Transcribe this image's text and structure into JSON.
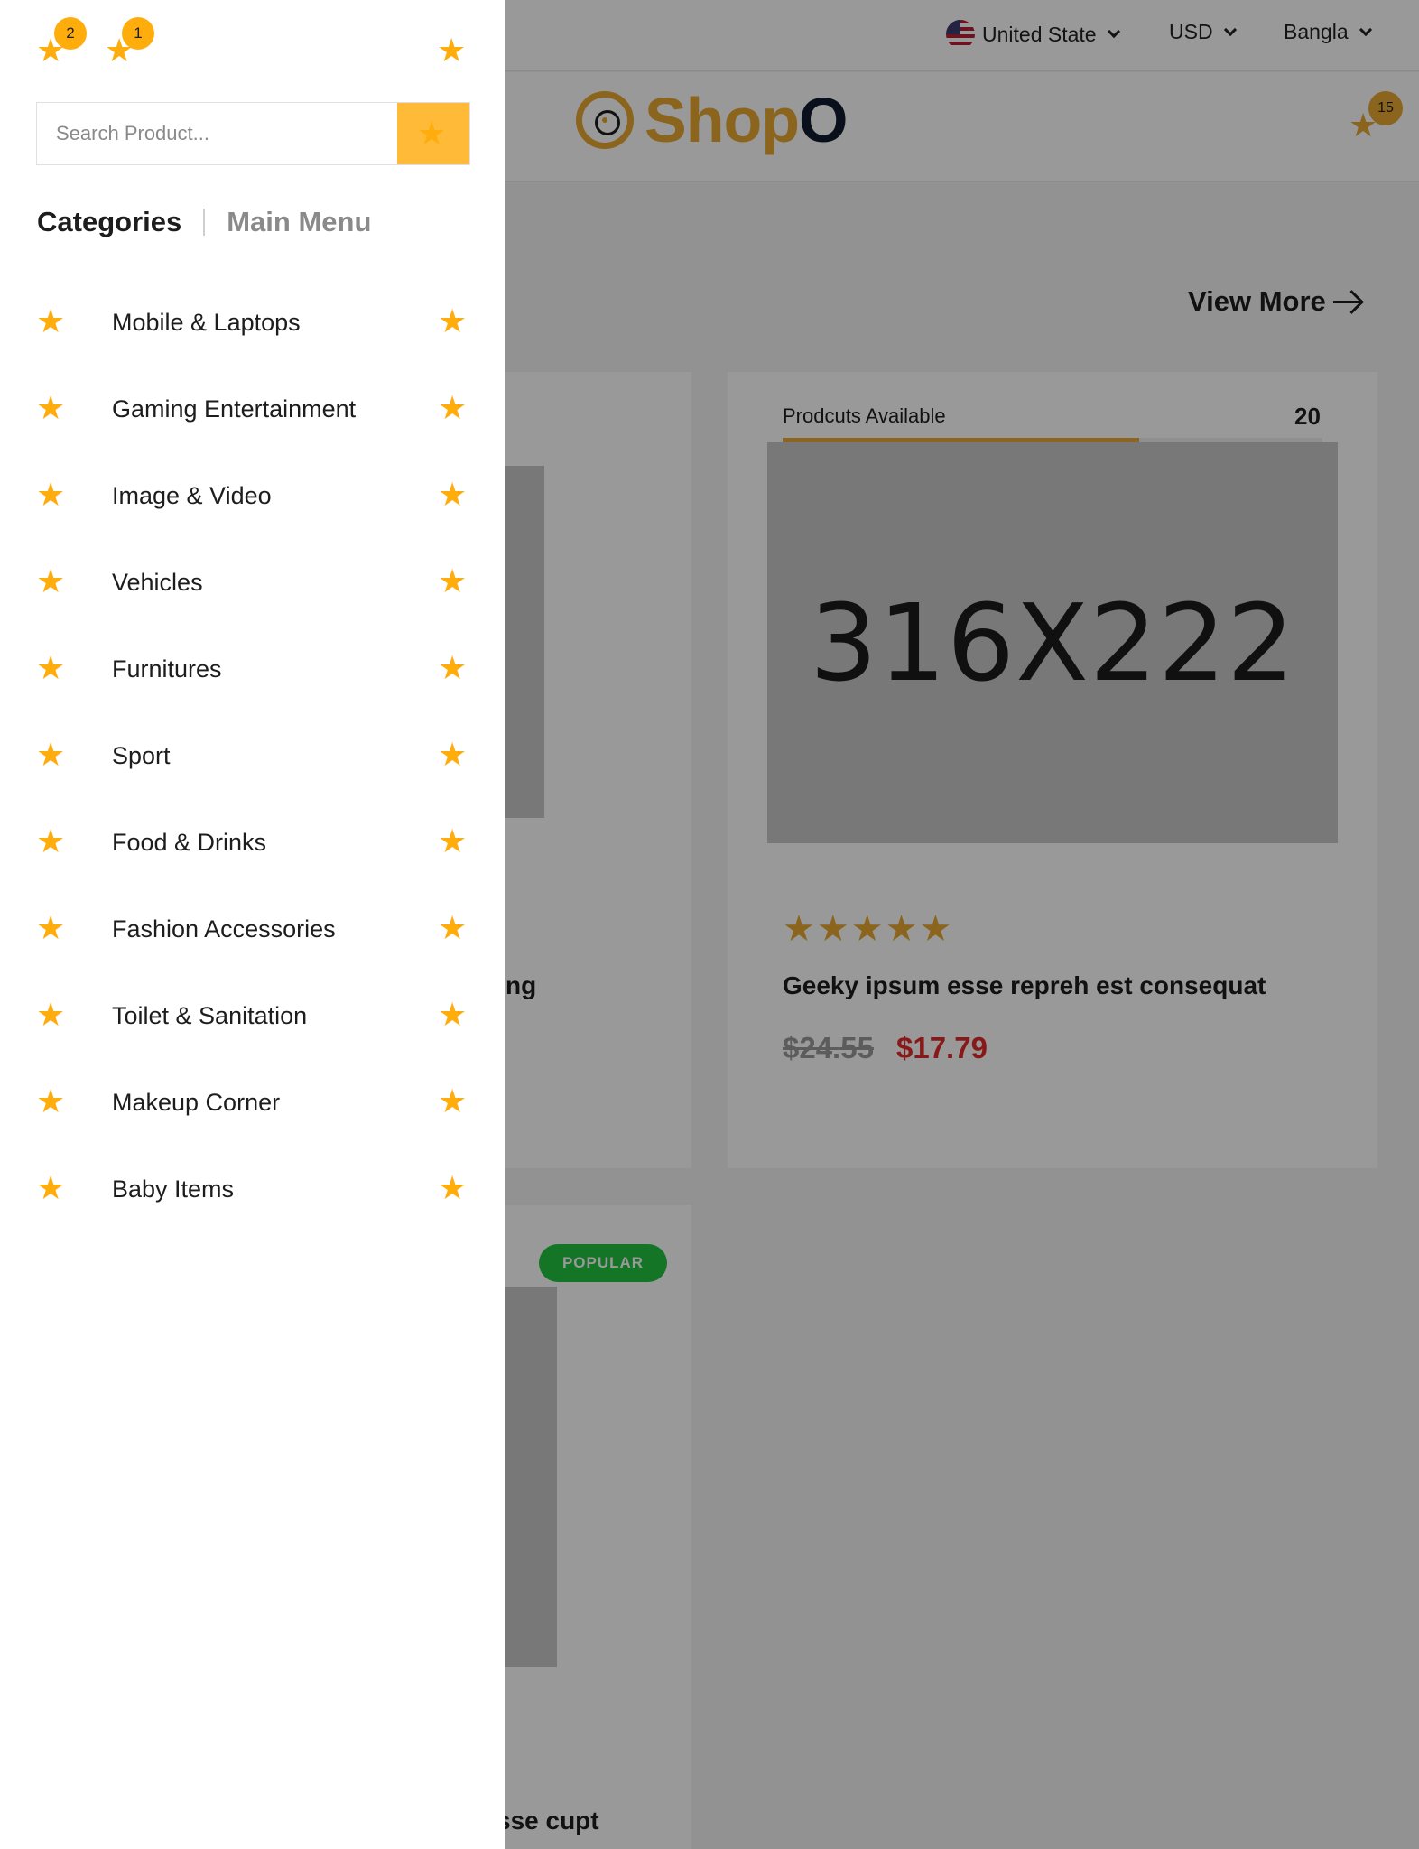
{
  "topbar": {
    "country": "United State",
    "currency": "USD",
    "language": "Bangla"
  },
  "header": {
    "logo_text_a": "Shop",
    "logo_text_b": "O",
    "cart_count": "15"
  },
  "section": {
    "view_more": "View More"
  },
  "cards": {
    "right": {
      "availability_label": "Prodcuts Available",
      "availability_count": "20",
      "availability_fill": 0.66,
      "image_placeholder": "316X222",
      "rating": "★★★★★",
      "title": "Geeky ipsum esse repreh est consequat",
      "price_old": "$24.55",
      "price_new": "$17.79"
    },
    "left_partial_title": "ng",
    "bottom_partial_title": "sse cupt",
    "popular_badge": "POPULAR"
  },
  "drawer": {
    "top_icons": [
      {
        "icon": "star-icon",
        "badge": "2"
      },
      {
        "icon": "star-icon",
        "badge": "1"
      }
    ],
    "close_icon": "star-icon",
    "search": {
      "placeholder": "Search Product...",
      "button_icon": "star-icon"
    },
    "tabs": {
      "active": "Categories",
      "inactive": "Main Menu"
    },
    "categories": [
      {
        "label": "Mobile & Laptops"
      },
      {
        "label": "Gaming Entertainment"
      },
      {
        "label": "Image & Video"
      },
      {
        "label": "Vehicles"
      },
      {
        "label": "Furnitures"
      },
      {
        "label": "Sport"
      },
      {
        "label": "Food & Drinks"
      },
      {
        "label": "Fashion Accessories"
      },
      {
        "label": "Toilet & Sanitation"
      },
      {
        "label": "Makeup Corner"
      },
      {
        "label": "Baby Items"
      }
    ]
  },
  "colors": {
    "accent": "#ffad0d",
    "brand": "#e8a731",
    "sale_price": "#e22b2b",
    "popular": "#20c43f"
  }
}
